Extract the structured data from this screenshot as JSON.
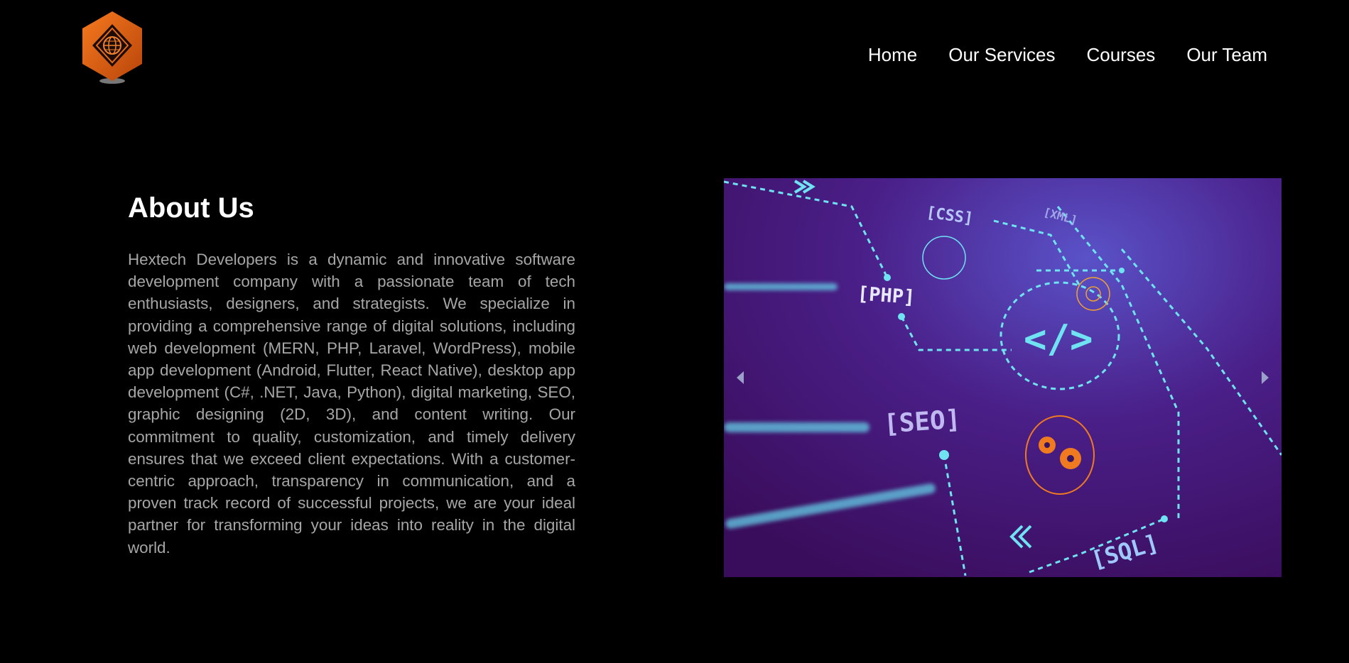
{
  "header": {
    "logo_icon": "hexagon-globe-logo",
    "nav": [
      {
        "label": "Home"
      },
      {
        "label": "Our Services"
      },
      {
        "label": "Courses"
      },
      {
        "label": "Our Team"
      }
    ]
  },
  "about": {
    "title": "About Us",
    "body": "Hextech Developers is a dynamic and innovative software development company with a passionate team of tech enthusiasts, designers, and strategists. We specialize in providing a comprehensive range of digital solutions, including web development (MERN, PHP, Laravel, WordPress), mobile app development (Android, Flutter, React Native), desktop app development (C#, .NET, Java, Python), digital marketing, SEO, graphic designing (2D, 3D), and content writing. Our commitment to quality, customization, and timely delivery ensures that we exceed client expectations. With a customer-centric approach, transparency in communication, and a proven track record of successful projects, we are your ideal partner for transforming your ideas into reality in the digital world."
  },
  "carousel": {
    "tags": {
      "css": "[CSS]",
      "xml": "[XML]",
      "php": "[PHP]",
      "seo": "[SEO]",
      "sql": "[SQL]",
      "code": "</>"
    },
    "prev_icon": "chevron-left-icon",
    "next_icon": "chevron-right-icon"
  },
  "colors": {
    "background": "#000000",
    "nav_text": "#ffffff",
    "body_text": "#a6a6a6",
    "logo_orange": "#e0600f",
    "circuit_cyan": "#6fe3f2",
    "carousel_purple": "#4a1a78"
  }
}
